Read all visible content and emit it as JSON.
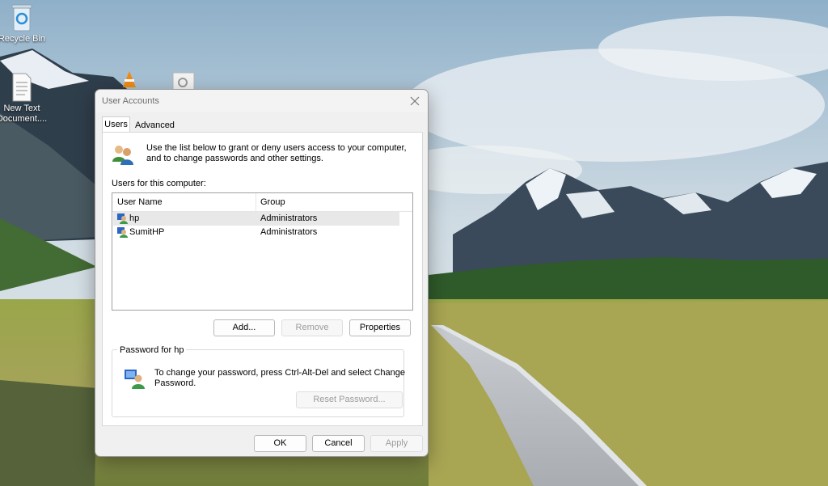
{
  "desktop": {
    "icons": [
      {
        "label": "Recycle Bin"
      },
      {
        "label": "New Text Document...."
      }
    ]
  },
  "dialog": {
    "title": "User Accounts",
    "tabs": [
      {
        "label": "Users",
        "selected": true
      },
      {
        "label": "Advanced",
        "selected": false
      }
    ],
    "intro_text": "Use the list below to grant or deny users access to your computer, and to change passwords and other settings.",
    "users_label": "Users for this computer:",
    "columns": {
      "user_name": "User Name",
      "group": "Group"
    },
    "rows": [
      {
        "name": "hp",
        "group": "Administrators",
        "selected": true
      },
      {
        "name": "SumitHP",
        "group": "Administrators",
        "selected": false
      }
    ],
    "buttons": {
      "add": "Add...",
      "remove": "Remove",
      "properties": "Properties",
      "reset_password": "Reset Password...",
      "ok": "OK",
      "cancel": "Cancel",
      "apply": "Apply"
    },
    "password_group": {
      "title": "Password for hp",
      "text": "To change your password, press Ctrl-Alt-Del and select Change Password."
    }
  }
}
